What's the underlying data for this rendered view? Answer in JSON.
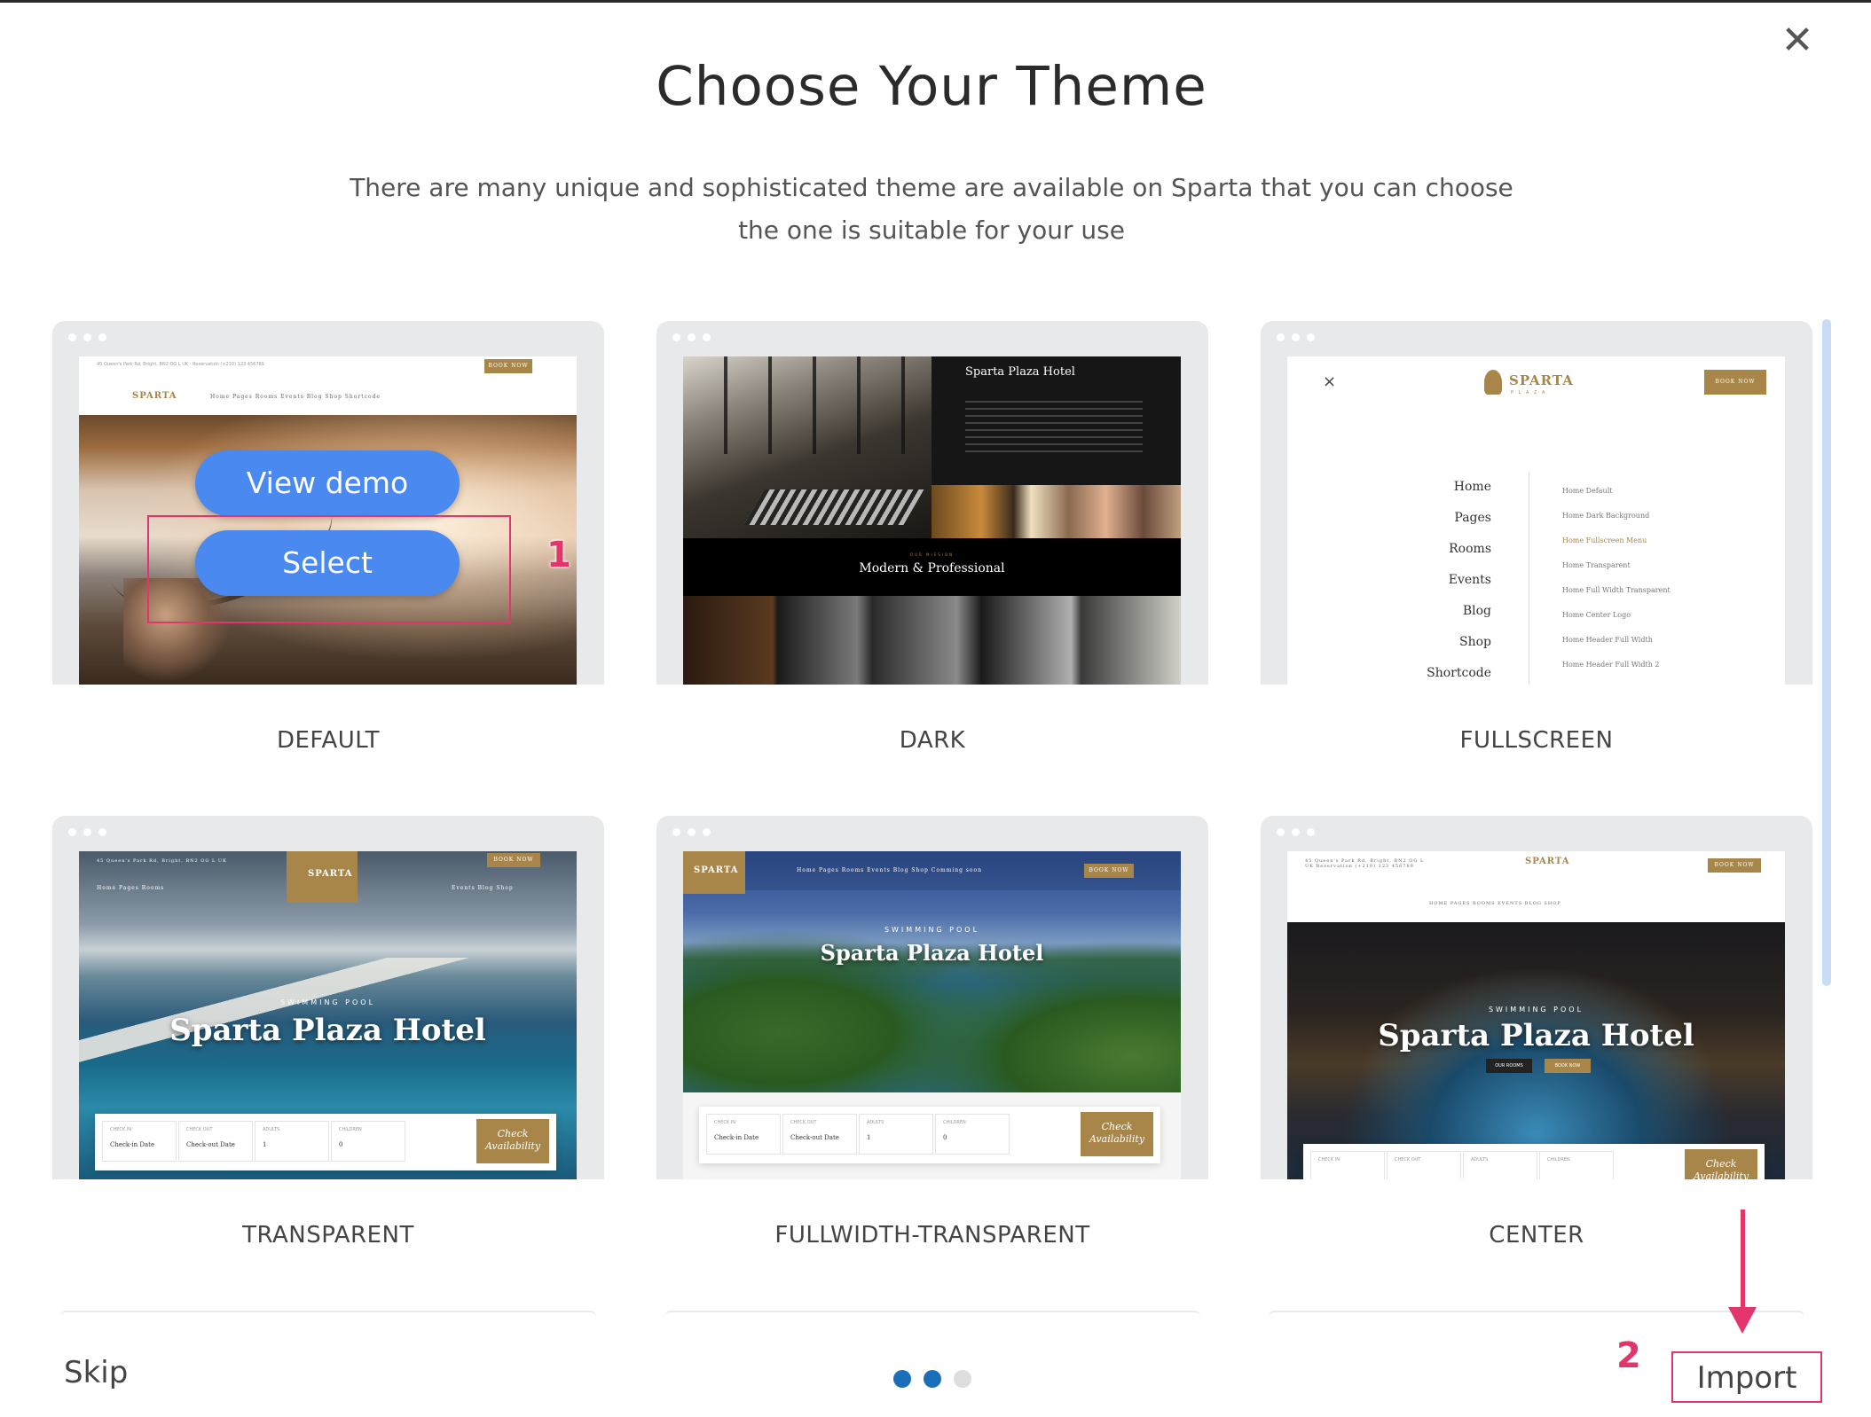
{
  "dialog": {
    "title": "Choose Your Theme",
    "subtitle_line1": "There are many unique and sophisticated theme are available on Sparta that you can choose",
    "subtitle_line2": "the one is suitable for your use",
    "close_icon": "close-icon"
  },
  "themes": [
    {
      "label": "DEFAULT",
      "view_demo": "View demo",
      "select": "Select",
      "preview": {
        "topbar": "45 Queen's Park Rd, Bright, BN2 OG L UK  -  Reservation (+210) 123 456789",
        "book": "BOOK NOW",
        "logo": "SPARTA",
        "nav": "Home    Pages    Rooms    Events    Blog    Shop    Shortcode"
      }
    },
    {
      "label": "DARK",
      "preview": {
        "heading": "Sparta Plaza Hotel",
        "tagline": "Modern & Professional",
        "small": "OUR MISSION"
      }
    },
    {
      "label": "FULLSCREEN",
      "preview": {
        "logo": "SPARTA",
        "logo_sub": "P L A Z A",
        "book": "BOOK NOW",
        "menu": [
          "Home",
          "Pages",
          "Rooms",
          "Events",
          "Blog",
          "Shop",
          "Shortcode"
        ],
        "submenu": [
          "Home Default",
          "Home Dark Background",
          "Home Fullscreen Menu",
          "Home Transparent",
          "Home Full Width Transparent",
          "Home Center Logo",
          "Home Header Full Width",
          "Home Header Full Width 2"
        ]
      }
    },
    {
      "label": "TRANSPARENT",
      "preview": {
        "topbar": "45 Queen's Park Rd, Bright, BN2 OG L UK",
        "book": "BOOK NOW",
        "logo": "SPARTA",
        "nav_left": "Home    Pages    Rooms",
        "nav_right": "Events    Blog    Shop",
        "kicker": "SWIMMING POOL",
        "heading": "Sparta Plaza Hotel",
        "fields": [
          {
            "cap": "CHECK IN",
            "val": "Check-in Date"
          },
          {
            "cap": "CHECK OUT",
            "val": "Check-out Date"
          },
          {
            "cap": "ADULTS",
            "val": "1"
          },
          {
            "cap": "CHILDREN",
            "val": "0"
          }
        ],
        "check": "Check Availability"
      }
    },
    {
      "label": "FULLWIDTH-TRANSPARENT",
      "preview": {
        "logo": "SPARTA",
        "nav": "Home    Pages    Rooms    Events    Blog    Shop    Comming soon",
        "book": "BOOK NOW",
        "kicker": "SWIMMING POOL",
        "heading": "Sparta Plaza Hotel",
        "fields": [
          {
            "cap": "CHECK IN",
            "val": "Check-in Date"
          },
          {
            "cap": "CHECK OUT",
            "val": "Check-out Date"
          },
          {
            "cap": "ADULTS",
            "val": "1"
          },
          {
            "cap": "CHILDREN",
            "val": "0"
          }
        ],
        "check": "Check Availability"
      }
    },
    {
      "label": "CENTER",
      "preview": {
        "topbar": "45 Queen's Park Rd, Bright, BN2 OG L UK  Reservation (+210) 123 456789",
        "logo": "SPARTA",
        "book": "BOOK NOW",
        "nav": "HOME    PAGES    ROOMS    EVENTS    BLOG    SHOP",
        "kicker": "SWIMMING POOL",
        "heading": "Sparta Plaza Hotel",
        "btn1": "OUR ROOMS",
        "btn2": "BOOK NOW",
        "fields": [
          {
            "cap": "CHECK IN",
            "val": ""
          },
          {
            "cap": "CHECK OUT",
            "val": ""
          },
          {
            "cap": "ADULTS",
            "val": ""
          },
          {
            "cap": "CHILDREN",
            "val": ""
          }
        ],
        "check": "Check Availability"
      }
    }
  ],
  "annotations": {
    "step1": "1",
    "step2": "2"
  },
  "footer": {
    "skip": "Skip",
    "import": "Import",
    "pages": [
      {
        "state": "active",
        "color": "#1a6fb8"
      },
      {
        "state": "active",
        "color": "#1a6fb8"
      },
      {
        "state": "inactive",
        "color": "#dddddd"
      }
    ]
  },
  "colors": {
    "accent": "#4a89f0",
    "gold": "#a8864a",
    "annotation": "#e2356b"
  }
}
